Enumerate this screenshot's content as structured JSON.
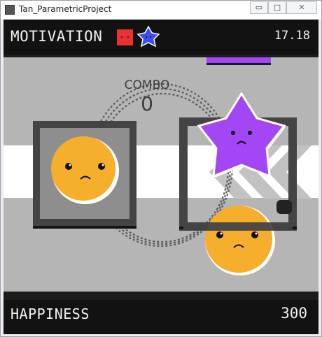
{
  "window": {
    "title": "Tan_ParametricProject",
    "buttons": {
      "minimize": "▭",
      "maximize": "□",
      "close": "✕"
    }
  },
  "hud": {
    "motivation_label": "MOTIVATION",
    "timer": "17.18",
    "happiness_label": "HAPPINESS",
    "score": "300"
  },
  "combo": {
    "label": "COMBO",
    "value": "0"
  },
  "colors": {
    "background": "#b5b5b5",
    "hud": "#121212",
    "orange": "#f6ae2d",
    "purple": "#a347f5",
    "red_square": "#e8322f",
    "blue_star": "#3d4df0",
    "frame": "#444444",
    "band": "#ffffff"
  }
}
